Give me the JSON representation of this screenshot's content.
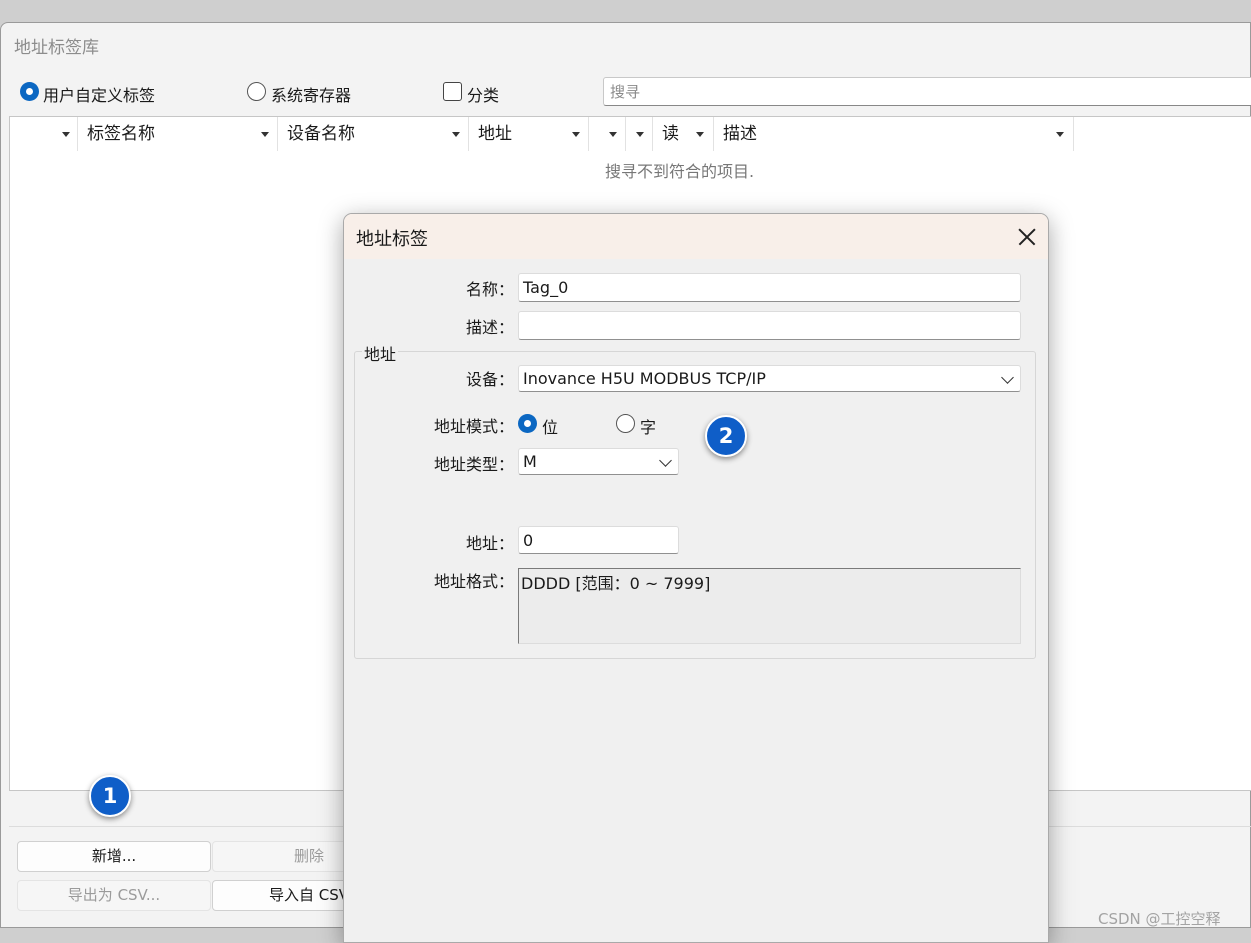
{
  "main": {
    "title": "地址标签库",
    "filters": {
      "user_defined_label": "用户自定义标签",
      "system_register_label": "系统寄存器",
      "category_label": "分类",
      "search_placeholder": "搜寻"
    },
    "table": {
      "columns": [
        "",
        "标签名称",
        "设备名称",
        "地址",
        "",
        "",
        "读",
        "描述"
      ],
      "empty_message": "搜寻不到符合的项目."
    },
    "buttons": {
      "add": "新增...",
      "delete": "删除",
      "export_csv": "导出为 CSV...",
      "import_csv": "导入自 CSV"
    }
  },
  "badges": [
    "1",
    "2"
  ],
  "dialog": {
    "title": "地址标签",
    "name_label": "名称：",
    "name_value": "Tag_0",
    "desc_label": "描述：",
    "desc_value": "",
    "group_label": "地址",
    "device_label": "设备：",
    "device_value": "Inovance H5U MODBUS TCP/IP",
    "mode_label": "地址模式：",
    "mode_bit": "位",
    "mode_word": "字",
    "mode_selected": "位",
    "type_label": "地址类型：",
    "type_value": "M",
    "address_label": "地址：",
    "address_value": "0",
    "format_label": "地址格式：",
    "format_value": "DDDD [范围：0 ~ 7999]"
  },
  "watermark": "CSDN @工控空释",
  "colors": {
    "accent": "#0b67c2",
    "badge": "#0f5ec8",
    "dialog_titlebar": "#f8efe9"
  }
}
